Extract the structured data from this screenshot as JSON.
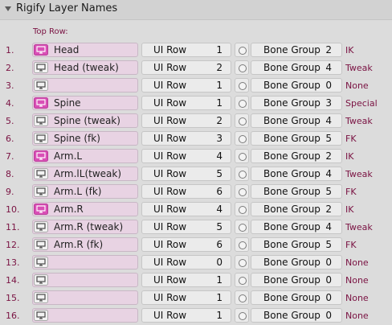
{
  "panel": {
    "title": "Rigify Layer Names",
    "top_row_label": "Top Row:"
  },
  "rows": [
    {
      "index": "1.",
      "name": "Head",
      "icon_active": true,
      "ui_row_label": "UI Row",
      "ui_row": "1",
      "bone_group_label": "Bone Group",
      "bone_group": "2",
      "tag": "IK"
    },
    {
      "index": "2.",
      "name": "Head (tweak)",
      "icon_active": false,
      "ui_row_label": "UI Row",
      "ui_row": "2",
      "bone_group_label": "Bone Group",
      "bone_group": "4",
      "tag": "Tweak"
    },
    {
      "index": "3.",
      "name": "",
      "icon_active": false,
      "ui_row_label": "UI Row",
      "ui_row": "1",
      "bone_group_label": "Bone Group",
      "bone_group": "0",
      "tag": "None"
    },
    {
      "index": "4.",
      "name": "Spine",
      "icon_active": true,
      "ui_row_label": "UI Row",
      "ui_row": "1",
      "bone_group_label": "Bone Group",
      "bone_group": "3",
      "tag": "Special"
    },
    {
      "index": "5.",
      "name": "Spine (tweak)",
      "icon_active": false,
      "ui_row_label": "UI Row",
      "ui_row": "2",
      "bone_group_label": "Bone Group",
      "bone_group": "4",
      "tag": "Tweak"
    },
    {
      "index": "6.",
      "name": "Spine (fk)",
      "icon_active": false,
      "ui_row_label": "UI Row",
      "ui_row": "3",
      "bone_group_label": "Bone Group",
      "bone_group": "5",
      "tag": "FK"
    },
    {
      "index": "7.",
      "name": "Arm.L",
      "icon_active": true,
      "ui_row_label": "UI Row",
      "ui_row": "4",
      "bone_group_label": "Bone Group",
      "bone_group": "2",
      "tag": "IK"
    },
    {
      "index": "8.",
      "name": "Arm.lL(tweak)",
      "icon_active": false,
      "ui_row_label": "UI Row",
      "ui_row": "5",
      "bone_group_label": "Bone Group",
      "bone_group": "4",
      "tag": "Tweak"
    },
    {
      "index": "9.",
      "name": "Arm.L (fk)",
      "icon_active": false,
      "ui_row_label": "UI Row",
      "ui_row": "6",
      "bone_group_label": "Bone Group",
      "bone_group": "5",
      "tag": "FK"
    },
    {
      "index": "10.",
      "name": "Arm.R",
      "icon_active": true,
      "ui_row_label": "UI Row",
      "ui_row": "4",
      "bone_group_label": "Bone Group",
      "bone_group": "2",
      "tag": "IK"
    },
    {
      "index": "11.",
      "name": "Arm.R (tweak)",
      "icon_active": false,
      "ui_row_label": "UI Row",
      "ui_row": "5",
      "bone_group_label": "Bone Group",
      "bone_group": "4",
      "tag": "Tweak"
    },
    {
      "index": "12.",
      "name": "Arm.R (fk)",
      "icon_active": false,
      "ui_row_label": "UI Row",
      "ui_row": "6",
      "bone_group_label": "Bone Group",
      "bone_group": "5",
      "tag": "FK"
    },
    {
      "index": "13.",
      "name": "",
      "icon_active": false,
      "ui_row_label": "UI Row",
      "ui_row": "0",
      "bone_group_label": "Bone Group",
      "bone_group": "0",
      "tag": "None"
    },
    {
      "index": "14.",
      "name": "",
      "icon_active": false,
      "ui_row_label": "UI Row",
      "ui_row": "1",
      "bone_group_label": "Bone Group",
      "bone_group": "0",
      "tag": "None"
    },
    {
      "index": "15.",
      "name": "",
      "icon_active": false,
      "ui_row_label": "UI Row",
      "ui_row": "1",
      "bone_group_label": "Bone Group",
      "bone_group": "0",
      "tag": "None"
    },
    {
      "index": "16.",
      "name": "",
      "icon_active": false,
      "ui_row_label": "UI Row",
      "ui_row": "1",
      "bone_group_label": "Bone Group",
      "bone_group": "0",
      "tag": "None"
    }
  ],
  "colors": {
    "accent_active_icon": "#d94fb6",
    "name_field_bg": "#e8d3e3",
    "label_text": "#7a1242"
  },
  "icons": {
    "row_icon": "monitor-icon",
    "collapse": "triangle-down-icon",
    "radio": "radio-circle-icon"
  }
}
